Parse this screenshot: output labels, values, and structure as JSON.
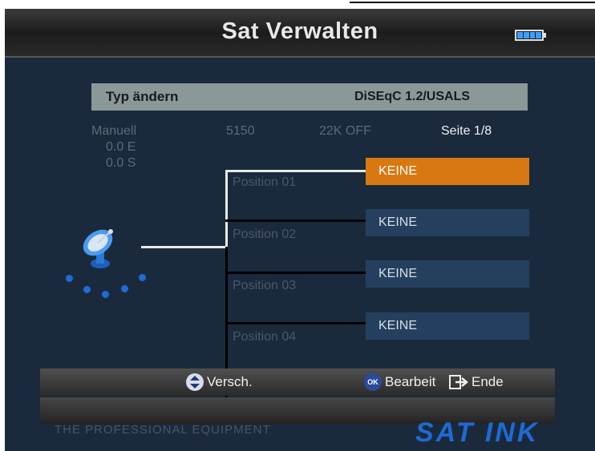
{
  "header": {
    "title": "Sat Verwalten",
    "battery_icon": "battery-icon"
  },
  "typ": {
    "label": "Typ ändern",
    "value": "DiSEqC 1.2/USALS"
  },
  "info": {
    "mode": "Manuell",
    "coord_e": "0.0 E",
    "coord_s": "0.0 S",
    "freq": "5150",
    "tone": "22K OFF",
    "page": "Seite 1/8"
  },
  "positions": [
    {
      "label": "Position  01",
      "value": "KEINE",
      "selected": true
    },
    {
      "label": "Position  02",
      "value": "KEINE",
      "selected": false
    },
    {
      "label": "Position  03",
      "value": "KEINE",
      "selected": false
    },
    {
      "label": "Position  04",
      "value": "KEINE",
      "selected": false
    }
  ],
  "footer": {
    "move_label": "Versch.",
    "ok_icon_text": "OK",
    "edit_label": "Bearbeit",
    "exit_label": "Ende"
  },
  "watermark": "THE PROFESSIONAL EQUIPMENT",
  "brand": "SAT INK",
  "colors": {
    "selected": "#d87810",
    "item": "#24405e",
    "background": "#1a2a3c"
  }
}
